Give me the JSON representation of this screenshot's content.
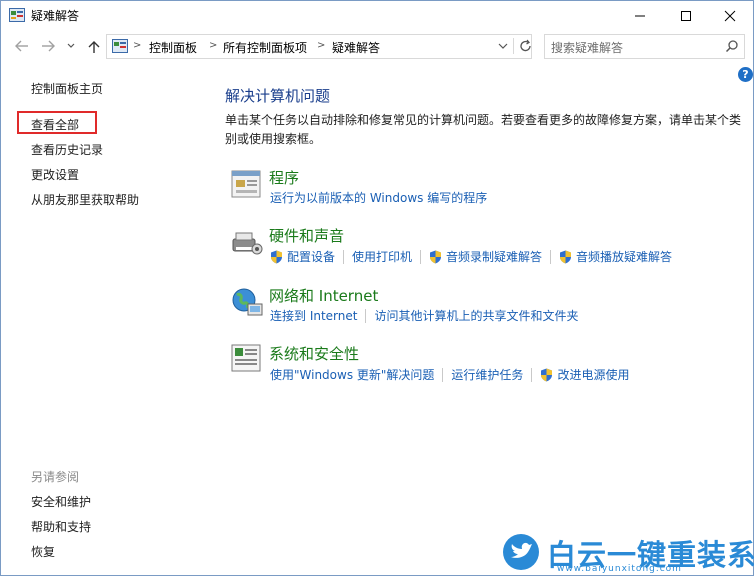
{
  "window": {
    "title": "疑难解答"
  },
  "address_bar": {
    "crumbs": [
      "控制面板",
      "所有控制面板项",
      "疑难解答"
    ]
  },
  "search": {
    "placeholder": "搜索疑难解答"
  },
  "help": {
    "label": "?"
  },
  "sidebar": {
    "items": [
      {
        "label": "控制面板主页"
      },
      {
        "label": "查看全部"
      },
      {
        "label": "查看历史记录"
      },
      {
        "label": "更改设置"
      },
      {
        "label": "从朋友那里获取帮助"
      }
    ],
    "see_also_title": "另请参阅",
    "see_also": [
      {
        "label": "安全和维护"
      },
      {
        "label": "帮助和支持"
      },
      {
        "label": "恢复"
      }
    ]
  },
  "main": {
    "title": "解决计算机问题",
    "description": "单击某个任务以自动排除和修复常见的计算机问题。若要查看更多的故障修复方案，请单击某个类别或使用搜索框。",
    "categories": [
      {
        "title": "程序",
        "links": [
          "运行为以前版本的 Windows 编写的程序"
        ],
        "icon": "programs-icon"
      },
      {
        "title": "硬件和声音",
        "links": [
          "配置设备",
          "使用打印机",
          "音频录制疑难解答",
          "音频播放疑难解答"
        ],
        "icon": "hardware-sound-icon"
      },
      {
        "title": "网络和 Internet",
        "links": [
          "连接到 Internet",
          "访问其他计算机上的共享文件和文件夹"
        ],
        "icon": "network-icon"
      },
      {
        "title": "系统和安全性",
        "links": [
          "使用\"Windows 更新\"解决问题",
          "运行维护任务",
          "改进电源使用"
        ],
        "icon": "system-security-icon"
      }
    ]
  },
  "watermark": {
    "text": "白云一键重装系统",
    "url": "www.baiyunxitong.com"
  },
  "colors": {
    "link": "#1a5fb4",
    "category_title": "#1a7a1a",
    "page_title": "#1a3e8c",
    "highlight": "#e02a2a"
  }
}
